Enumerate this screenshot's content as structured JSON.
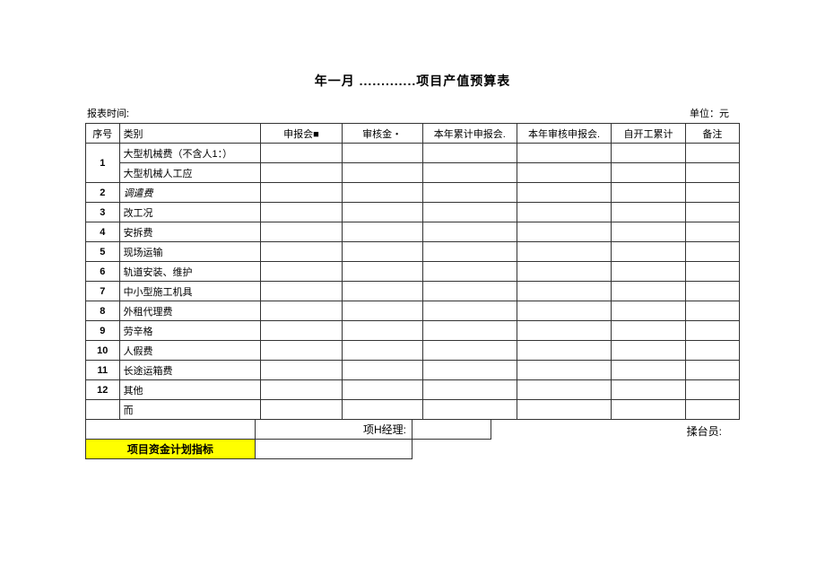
{
  "title": "年一月 .............项目产值预算表",
  "meta": {
    "left": "报表时间:",
    "right": "单位：元"
  },
  "headers": {
    "seq": "序号",
    "category": "类别",
    "c1": "申报会■",
    "c2": "审核金・",
    "c3": "本年累计申报会.",
    "c4": "本年审核申报会.",
    "c5": "自开工累计",
    "c6": "备注"
  },
  "rows": [
    {
      "seq": "1",
      "category": "大型机械费（不含人1：）",
      "rowspan": 2
    },
    {
      "seq": "",
      "category": "大型机械人工应"
    },
    {
      "seq": "2",
      "category": "调遣费",
      "italic": true
    },
    {
      "seq": "3",
      "category": "改工况"
    },
    {
      "seq": "4",
      "category": "安拆费"
    },
    {
      "seq": "5",
      "category": "现场运输"
    },
    {
      "seq": "6",
      "category": "轨道安装、维护"
    },
    {
      "seq": "7",
      "category": "中小型施工机具"
    },
    {
      "seq": "8",
      "category": "外租代理费"
    },
    {
      "seq": "9",
      "category": "劳辛格"
    },
    {
      "seq": "10",
      "category": "人假费"
    },
    {
      "seq": "11",
      "category": "长途运箱费"
    },
    {
      "seq": "12",
      "category": "其他"
    },
    {
      "seq": "",
      "category": "而"
    }
  ],
  "footer": {
    "pm_label": "项H经理:",
    "operator_label": "揉台员:",
    "yellow_label": "项目资金计划指标"
  }
}
